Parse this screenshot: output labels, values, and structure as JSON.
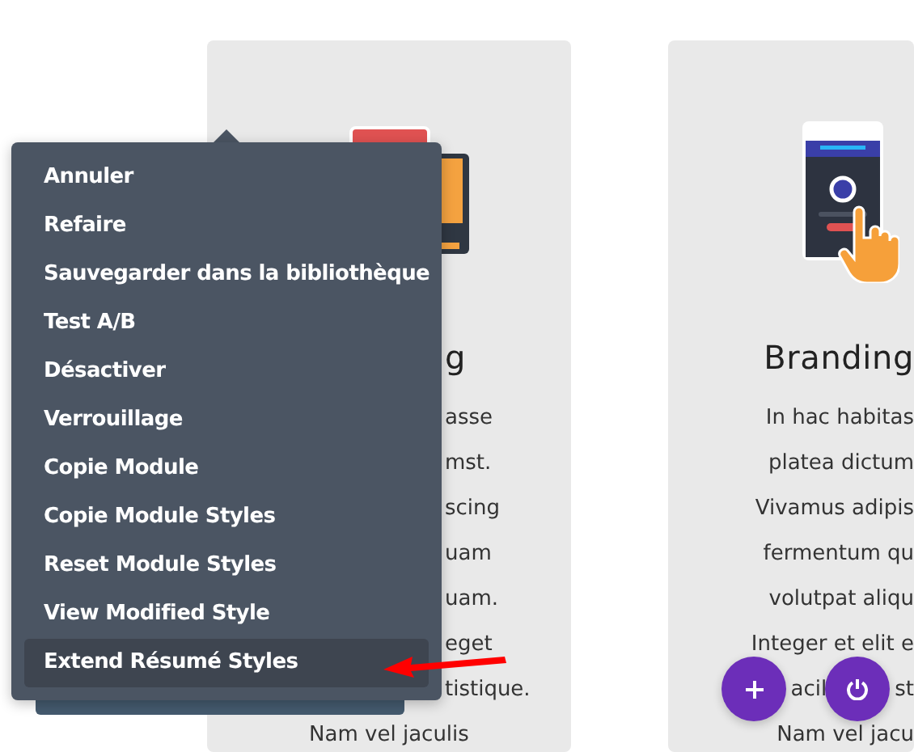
{
  "cards": [
    {
      "heading": {
        "text": "g",
        "kind": "clipped_left"
      },
      "lines": [
        {
          "text": "asse",
          "kind": "clipped_left"
        },
        {
          "text": "mst.",
          "kind": "clipped_left"
        },
        {
          "text": "scing",
          "kind": "clipped_left"
        },
        {
          "text": "uam",
          "kind": "clipped_left"
        },
        {
          "text": "uam.",
          "kind": "clipped_left"
        },
        {
          "text": "eget",
          "kind": "clipped_left"
        },
        {
          "text": "tistique.",
          "kind": "clipped_left"
        },
        {
          "text": "Nam vel jaculis",
          "kind": "full"
        }
      ]
    },
    {
      "heading": {
        "text": "Branding",
        "kind": "clipped_right"
      },
      "lines": [
        {
          "text": "In hac habitas",
          "kind": "clipped_right"
        },
        {
          "text": "platea dictum",
          "kind": "clipped_right"
        },
        {
          "text": "Vivamus adipis",
          "kind": "clipped_right"
        },
        {
          "text": "fermentum qu",
          "kind": "clipped_right"
        },
        {
          "text": "volutpat aliqu",
          "kind": "clipped_right"
        },
        {
          "text": "Integer et elit e",
          "kind": "clipped_right"
        },
        {
          "segments": [
            "acil",
            "st"
          ],
          "kind": "broken"
        },
        {
          "text": "Nam vel jacu",
          "kind": "clipped_right"
        }
      ]
    }
  ],
  "context_menu": {
    "items": [
      {
        "label": "Annuler",
        "selected": false
      },
      {
        "label": "Refaire",
        "selected": false
      },
      {
        "label": "Sauvegarder dans la bibliothèque",
        "selected": false
      },
      {
        "label": "Test A/B",
        "selected": false
      },
      {
        "label": "Désactiver",
        "selected": false
      },
      {
        "label": "Verrouillage",
        "selected": false
      },
      {
        "label": "Copie Module",
        "selected": false
      },
      {
        "label": "Copie Module Styles",
        "selected": false
      },
      {
        "label": "Reset Module Styles",
        "selected": false
      },
      {
        "label": "View Modified Style",
        "selected": false
      },
      {
        "label": "Extend Résumé Styles",
        "selected": true
      }
    ]
  }
}
